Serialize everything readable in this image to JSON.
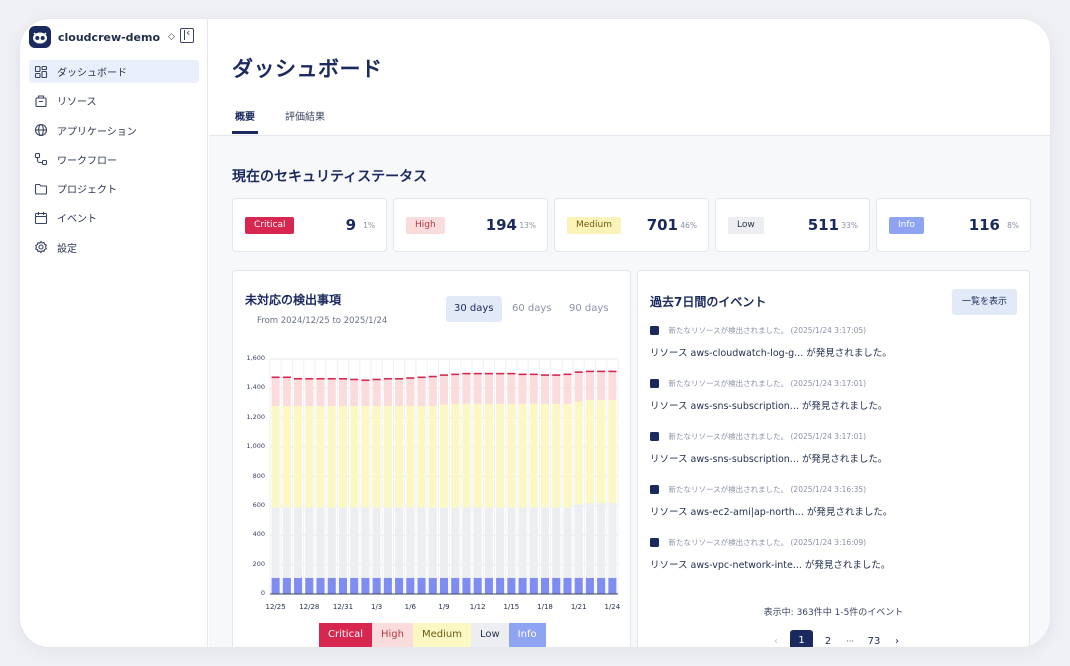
{
  "org": {
    "name": "cloudcrew-demo",
    "switch_icon": "chevron-up-down-icon"
  },
  "sidebar": {
    "items": [
      {
        "label": "ダッシュボード",
        "icon": "dashboard-icon",
        "active": true
      },
      {
        "label": "リソース",
        "icon": "resource-icon"
      },
      {
        "label": "アプリケーション",
        "icon": "globe-icon"
      },
      {
        "label": "ワークフロー",
        "icon": "workflow-icon"
      },
      {
        "label": "プロジェクト",
        "icon": "folder-icon"
      },
      {
        "label": "イベント",
        "icon": "calendar-icon"
      },
      {
        "label": "設定",
        "icon": "gear-icon"
      }
    ]
  },
  "header": {
    "title": "ダッシュボード",
    "tabs": [
      {
        "label": "概要",
        "active": true
      },
      {
        "label": "評価結果"
      }
    ]
  },
  "status": {
    "title": "現在のセキュリティステータス",
    "cards": [
      {
        "label": "Critical",
        "count": "9",
        "pct": "1%",
        "bg": "#d7264f",
        "fg": "#ffffff"
      },
      {
        "label": "High",
        "count": "194",
        "pct": "13%",
        "bg": "#fadcdc",
        "fg": "#b03a48"
      },
      {
        "label": "Medium",
        "count": "701",
        "pct": "46%",
        "bg": "#fbf3b8",
        "fg": "#6b5b12"
      },
      {
        "label": "Low",
        "count": "511",
        "pct": "33%",
        "bg": "#eceef2",
        "fg": "#2a3550"
      },
      {
        "label": "Info",
        "count": "116",
        "pct": "8%",
        "bg": "#8ea3f2",
        "fg": "#ffffff"
      }
    ]
  },
  "findings": {
    "title": "未対応の検出事項",
    "subtitle": "From 2024/12/25 to 2025/1/24",
    "ranges": [
      {
        "label": "30 days",
        "active": true
      },
      {
        "label": "60 days"
      },
      {
        "label": "90 days"
      }
    ]
  },
  "chart_data": {
    "type": "bar",
    "stacked": true,
    "ylim": [
      0,
      1600
    ],
    "yticks": [
      "0",
      "200",
      "400",
      "600",
      "800",
      "1,000",
      "1,200",
      "1,400",
      "1,600"
    ],
    "xticks": [
      "12/25",
      "12/28",
      "12/31",
      "1/3",
      "1/6",
      "1/9",
      "1/12",
      "1/15",
      "1/18",
      "1/21",
      "1/24"
    ],
    "grid": true,
    "colors": {
      "Info": "#7f8cf0",
      "Low": "#eceef2",
      "Medium": "#fbf8c4",
      "High": "#fadcdc",
      "Critical": "#d7264f"
    },
    "series": [
      {
        "name": "Info",
        "values": [
          110,
          110,
          110,
          110,
          110,
          110,
          110,
          110,
          110,
          110,
          110,
          110,
          110,
          110,
          110,
          110,
          110,
          110,
          110,
          110,
          110,
          110,
          110,
          110,
          110,
          110,
          110,
          110,
          110,
          110,
          110
        ]
      },
      {
        "name": "Low",
        "values": [
          480,
          480,
          480,
          480,
          480,
          480,
          480,
          480,
          480,
          480,
          480,
          480,
          480,
          480,
          480,
          480,
          480,
          480,
          480,
          480,
          480,
          480,
          480,
          480,
          480,
          480,
          480,
          500,
          510,
          510,
          510
        ]
      },
      {
        "name": "Medium",
        "values": [
          690,
          690,
          690,
          690,
          690,
          690,
          690,
          690,
          690,
          690,
          690,
          690,
          690,
          690,
          690,
          700,
          705,
          705,
          705,
          705,
          705,
          705,
          705,
          705,
          705,
          705,
          705,
          700,
          700,
          700,
          700
        ]
      },
      {
        "name": "High",
        "values": [
          190,
          190,
          180,
          180,
          180,
          180,
          180,
          175,
          170,
          175,
          180,
          180,
          185,
          190,
          195,
          195,
          195,
          200,
          200,
          200,
          200,
          200,
          195,
          195,
          190,
          190,
          195,
          195,
          190,
          190,
          190
        ]
      },
      {
        "name": "Critical",
        "values": [
          9,
          9,
          9,
          9,
          9,
          9,
          9,
          9,
          9,
          9,
          9,
          9,
          9,
          9,
          9,
          9,
          9,
          9,
          9,
          9,
          9,
          9,
          9,
          9,
          9,
          9,
          9,
          9,
          9,
          9,
          9
        ]
      }
    ],
    "legend": [
      "Critical",
      "High",
      "Medium",
      "Low",
      "Info"
    ]
  },
  "events": {
    "title": "過去7日間のイベント",
    "view_all": "一覧を表示",
    "items": [
      {
        "meta": "新たなリソースが検出されました。 (2025/1/24 3:17:05)",
        "msg": "リソース aws-cloudwatch-log-g... が発見されました。"
      },
      {
        "meta": "新たなリソースが検出されました。 (2025/1/24 3:17:01)",
        "msg": "リソース aws-sns-subscription... が発見されました。"
      },
      {
        "meta": "新たなリソースが検出されました。 (2025/1/24 3:17:01)",
        "msg": "リソース aws-sns-subscription... が発見されました。"
      },
      {
        "meta": "新たなリソースが検出されました。 (2025/1/24 3:16:35)",
        "msg": "リソース aws-ec2-ami|ap-north... が発見されました。"
      },
      {
        "meta": "新たなリソースが検出されました。 (2025/1/24 3:16:09)",
        "msg": "リソース aws-vpc-network-inte... が発見されました。"
      }
    ],
    "footer": "表示中: 363件中 1-5件のイベント",
    "pager": {
      "prev": "‹",
      "current": "1",
      "next_page": "2",
      "ellipsis": "···",
      "last": "73",
      "next": "›"
    }
  }
}
